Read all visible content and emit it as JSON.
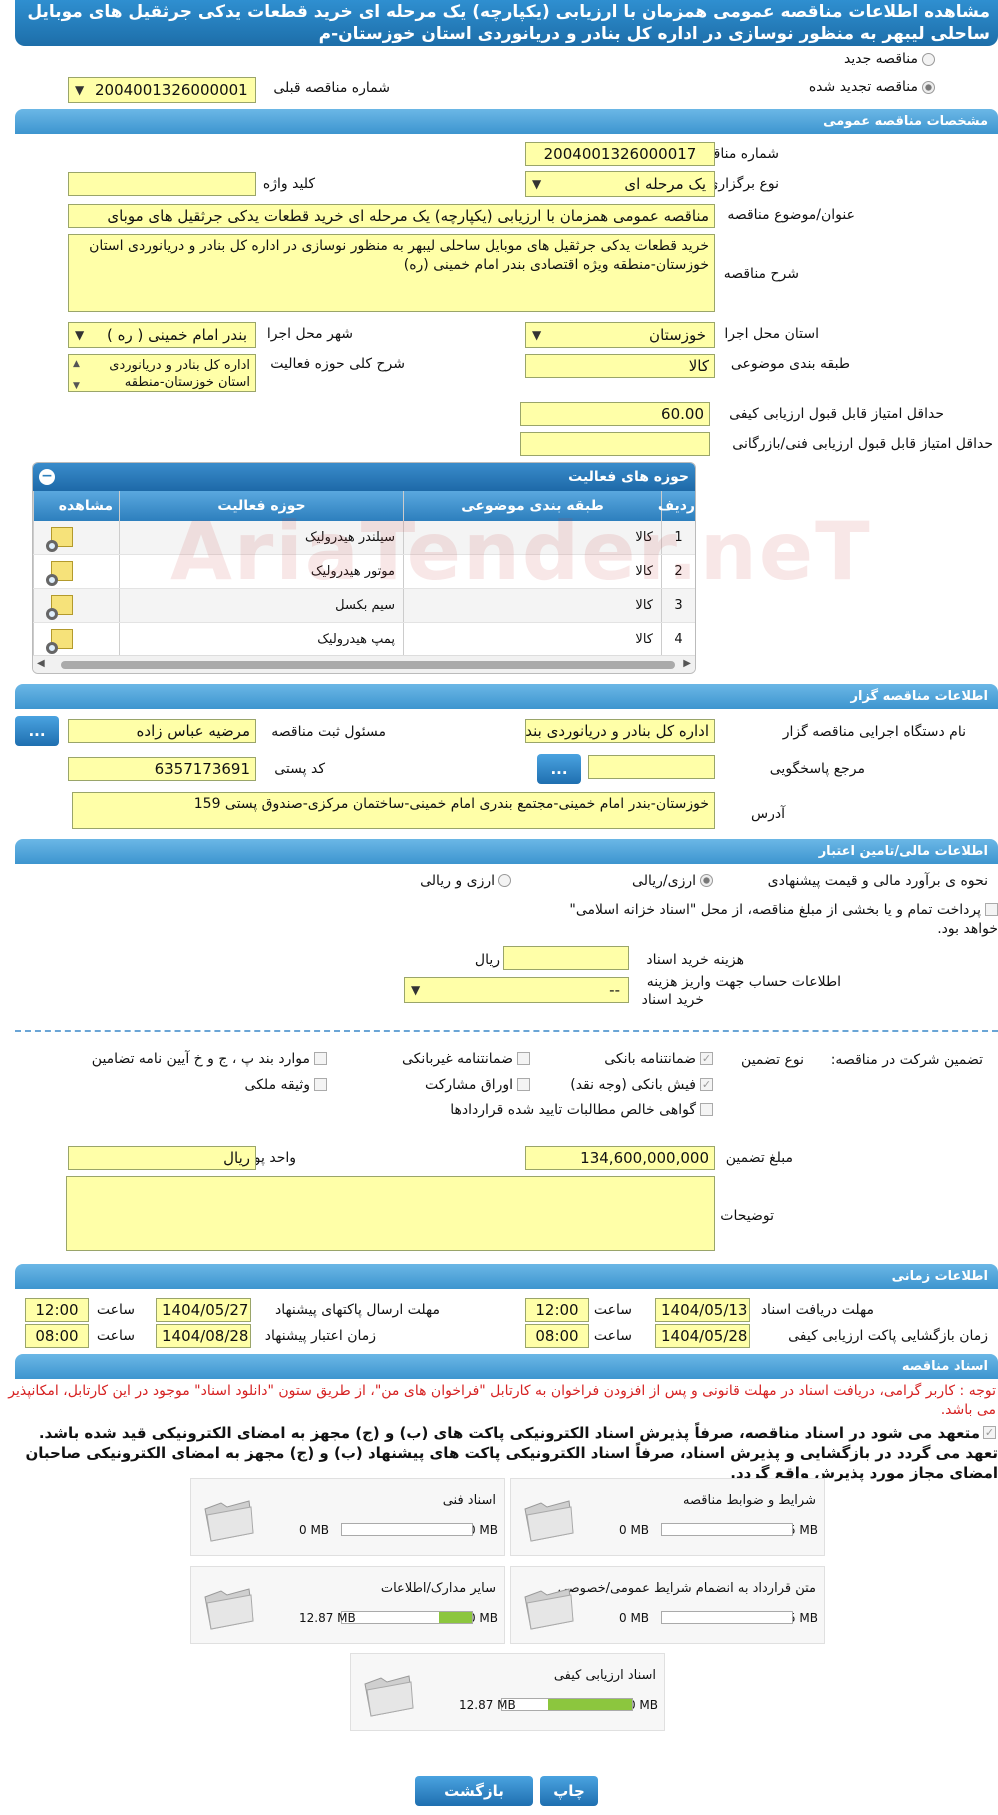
{
  "page_title": "مشاهده اطلاعات مناقصه عمومی همزمان با ارزیابی (یکپارچه) یک مرحله ای خرید قطعات یدکی جرثقیل های موبایل ساحلی لیبهر به منظور نوسازی در اداره کل بنادر و دریانوردی استان خوزستان-م",
  "top": {
    "new_tender": "مناقصه جدید",
    "renewed_tender": "مناقصه تجدید شده",
    "prev_number_label": "شماره مناقصه قبلی",
    "prev_number": "2004001326000001"
  },
  "general": {
    "section": "مشخصات مناقصه عمومی",
    "number_label": "شماره مناقصه",
    "number": "2004001326000017",
    "type_label": "نوع برگزاری",
    "type": "یک مرحله ای",
    "keyword_label": "کلید واژه",
    "keyword": "",
    "subject_label": "عنوان/موضوع مناقصه",
    "subject": "مناقصه عمومی همزمان با ارزیابی (یکپارچه) یک مرحله ای خرید قطعات یدکی جرثقیل های موبای",
    "desc_label": "شرح مناقصه",
    "desc": "خرید قطعات یدکی جرثقیل های موبایل ساحلی لیبهر به منظور نوسازی در اداره کل بنادر و دریانوردی استان خوزستان-منطقه ویژه اقتصادی بندر امام خمینی (ره)",
    "province_label": "استان محل اجرا",
    "province": "خوزستان",
    "city_label": "شهر محل اجرا",
    "city": "بندر امام خمینی ( ره )",
    "category_label": "طبقه بندی موضوعی",
    "category": "کالا",
    "activity_label": "شرح کلی حوزه فعالیت",
    "activity": "اداره کل بنادر و دریانوردی استان خوزستان-منطقه",
    "min_quality_label": "حداقل امتیاز قابل قبول ارزیابی کیفی",
    "min_quality": "60.00",
    "min_tech_label": "حداقل امتیاز قابل قبول ارزیابی فنی/بازرگانی",
    "min_tech": ""
  },
  "activities": {
    "title": "حوزه های فعالیت",
    "headers": [
      "ردیف",
      "طبقه بندی موضوعی",
      "حوزه فعالیت",
      "مشاهده"
    ],
    "rows": [
      [
        "1",
        "کالا",
        "سیلندر هیدرولیک"
      ],
      [
        "2",
        "کالا",
        "موتور هیدرولیک"
      ],
      [
        "3",
        "کالا",
        "سیم بکسل"
      ],
      [
        "4",
        "کالا",
        "پمپ هیدرولیک"
      ]
    ],
    "watermark": "AriaTender.neT"
  },
  "org": {
    "section": "اطلاعات مناقصه گزار",
    "device_label": "نام دستگاه اجرایی مناقصه گزار",
    "device": "اداره کل بنادر و دریانوردی بند",
    "registrar_label": "مسئول ثبت مناقصه",
    "registrar": "مرضیه عباس زاده",
    "responder_label": "مرجع پاسخگویی",
    "responder": "",
    "postal_label": "کد پستی",
    "postal": "6357173691",
    "address_label": "آدرس",
    "address": "خوزستان-بندر امام خمینی-مجتمع بندری امام خمینی-ساختمان مرکزی-صندوق پستی 159",
    "dots": "..."
  },
  "finance": {
    "section": "اطلاعات مالی/تامین اعتبار",
    "estimate_label": "نحوه ی برآورد مالی و قیمت پیشنهادی",
    "opt1": "ارزی/ریالی",
    "opt2": "ارزی و ریالی",
    "treasury_line1": "پرداخت تمام و یا بخشی از مبلغ مناقصه، از محل \"اسناد خزانه اسلامی\"",
    "treasury_line2": "خواهد بود.",
    "doc_cost_label": "هزینه خرید اسناد",
    "doc_cost": "",
    "doc_cost_unit": "ریال",
    "account_label1": "اطلاعات حساب جهت واریز هزینه",
    "account_label2": "خرید اسناد",
    "account": "--"
  },
  "guarantee": {
    "participation_label": "تضمین شرکت در مناقصه:",
    "type_label": "نوع تضمین",
    "bank_guarantee": "ضمانتنامه بانکی",
    "nonbank_guarantee": "ضمانتنامه غیربانکی",
    "cases": "موارد بند پ ، ج و خ آیین نامه تضامین",
    "cheque": "فیش بانکی (وجه نقد)",
    "bonds": "اوراق مشارکت",
    "property": "وثیقه ملکی",
    "claims": "گواهی خالص مطالبات تایید شده قراردادها",
    "amount_label": "مبلغ تضمین",
    "amount": "134,600,000,000",
    "currency_label": "واحد پول",
    "currency": "ریال",
    "notes_label": "توضیحات",
    "notes": ""
  },
  "time": {
    "section": "اطلاعات زمانی",
    "receive_label": "مهلت دریافت اسناد",
    "receive_date": "1404/05/13",
    "receive_time": "12:00",
    "send_label": "مهلت ارسال پاکتهای پیشنهاد",
    "send_date": "1404/05/27",
    "send_time": "12:00",
    "open_label": "زمان بازگشایی پاکت ارزیابی کیفی",
    "open_date": "1404/05/28",
    "open_time": "08:00",
    "valid_label": "زمان اعتبار پیشنهاد",
    "valid_date": "1404/08/28",
    "valid_time": "08:00",
    "hour_label": "ساعت"
  },
  "docs": {
    "section": "اسناد مناقصه",
    "note": "توجه : کاربر گرامی، دریافت اسناد در مهلت قانونی و پس از افزودن فراخوان به کارتابل \"فراخوان های من\"، از طریق ستون \"دانلود اسناد\" موجود در این کارتابل، امکانپذیر می باشد.",
    "commit": "متعهد می شود در اسناد مناقصه، صرفاً پذیرش اسناد الکترونیکی پاکت های (ب) و (ج) مجهز به امضای الکترونیکی قید شده باشد. تعهد می گردد در بازگشایی و پذیرش اسناد، صرفاً اسناد الکترونیکی پاکت های پیشنهاد (ب) و (ج) مجهز به امضای الکترونیکی صاحبان امضای مجاز مورد پذیرش واقع گردد.",
    "files": [
      {
        "name": "شرایط و ضوابط مناقصه",
        "max": "5 MB",
        "cur": "0 MB",
        "fill": 0
      },
      {
        "name": "اسناد فنی",
        "max": "50 MB",
        "cur": "0 MB",
        "fill": 0
      },
      {
        "name": "متن قرارداد به انضمام شرایط عمومی/خصوصی",
        "max": "5 MB",
        "cur": "0 MB",
        "fill": 0
      },
      {
        "name": "سایر مدارک/اطلاعات",
        "max": "50 MB",
        "cur": "12.87 MB",
        "fill": 0.2574
      },
      {
        "name": "اسناد ارزیابی کیفی",
        "max": "20 MB",
        "cur": "12.87 MB",
        "fill": 0.6435
      }
    ]
  },
  "buttons": {
    "print": "چاپ",
    "back": "بازگشت"
  }
}
